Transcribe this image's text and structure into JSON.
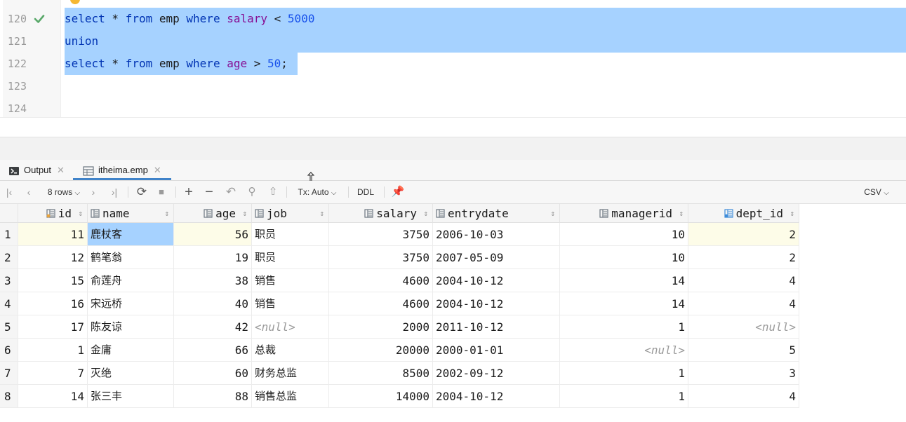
{
  "editor": {
    "lines": [
      {
        "num": "120",
        "tokens": [
          "select",
          " * ",
          "from",
          " emp ",
          "where",
          " ",
          "salary",
          " < ",
          "5000"
        ]
      },
      {
        "num": "121",
        "tokens": [
          "union"
        ]
      },
      {
        "num": "122",
        "tokens": [
          "select",
          " * ",
          "from",
          " emp ",
          "where",
          " ",
          "age",
          " > ",
          "50",
          ";"
        ]
      },
      {
        "num": "123",
        "tokens": []
      },
      {
        "num": "124",
        "tokens": []
      }
    ]
  },
  "tabs": [
    {
      "label": "Output",
      "icon": "output-icon"
    },
    {
      "label": "itheima.emp",
      "icon": "table-icon"
    }
  ],
  "toolbar": {
    "rows_label": "8 rows",
    "tx_label": "Tx: Auto",
    "ddl_label": "DDL",
    "export_label": "CSV"
  },
  "grid": {
    "columns": [
      "id",
      "name",
      "age",
      "job",
      "salary",
      "entrydate",
      "managerid",
      "dept_id"
    ],
    "rows": [
      {
        "n": "1",
        "cells": [
          "11",
          "鹿杖客",
          "56",
          "职员",
          "3750",
          "2006-10-03",
          "10",
          "2"
        ]
      },
      {
        "n": "2",
        "cells": [
          "12",
          "鹤笔翁",
          "19",
          "职员",
          "3750",
          "2007-05-09",
          "10",
          "2"
        ]
      },
      {
        "n": "3",
        "cells": [
          "15",
          "俞莲舟",
          "38",
          "销售",
          "4600",
          "2004-10-12",
          "14",
          "4"
        ]
      },
      {
        "n": "4",
        "cells": [
          "16",
          "宋远桥",
          "40",
          "销售",
          "4600",
          "2004-10-12",
          "14",
          "4"
        ]
      },
      {
        "n": "5",
        "cells": [
          "17",
          "陈友谅",
          "42",
          "<null>",
          "2000",
          "2011-10-12",
          "1",
          "<null>"
        ]
      },
      {
        "n": "6",
        "cells": [
          "1",
          "金庸",
          "66",
          "总裁",
          "20000",
          "2000-01-01",
          "<null>",
          "5"
        ]
      },
      {
        "n": "7",
        "cells": [
          "7",
          "灭绝",
          "60",
          "财务总监",
          "8500",
          "2002-09-12",
          "1",
          "3"
        ]
      },
      {
        "n": "8",
        "cells": [
          "14",
          "张三丰",
          "88",
          "销售总监",
          "14000",
          "2004-10-12",
          "1",
          "4"
        ]
      }
    ]
  },
  "colors": {
    "selection": "#a6d2ff",
    "keyword": "#0033b3",
    "column": "#871094",
    "number": "#1750eb",
    "check": "#59a869"
  }
}
